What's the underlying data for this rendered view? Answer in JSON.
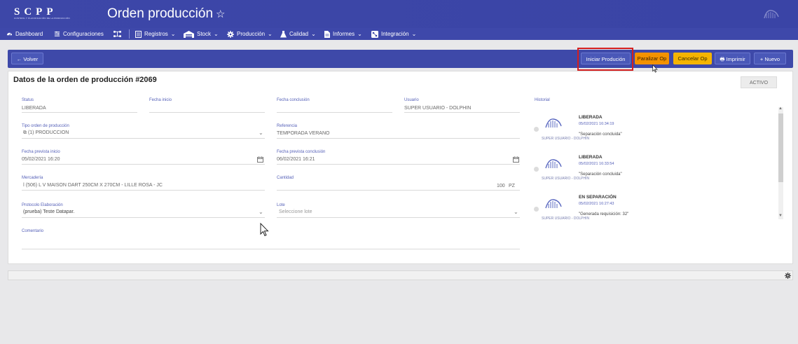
{
  "header": {
    "logo_text": "SCPP",
    "logo_subtitle": "CONTROL Y PLANIFICACIÓN DE LA PRODUCCIÓN",
    "title": "Orden producción",
    "star_icon": "star-outline-icon"
  },
  "nav": {
    "items": [
      {
        "label": "Dashboard",
        "icon": "dashboard-icon"
      },
      {
        "label": "Configuraciones",
        "icon": "sliders-icon"
      },
      {
        "label": "",
        "icon": "workflow-icon"
      },
      {
        "label": "Registros",
        "icon": "register-icon"
      },
      {
        "label": "Stock",
        "icon": "warehouse-icon"
      },
      {
        "label": "Producción",
        "icon": "gear-icon"
      },
      {
        "label": "Calidad",
        "icon": "flask-icon"
      },
      {
        "label": "Informes",
        "icon": "document-icon"
      },
      {
        "label": "Integración",
        "icon": "integration-icon"
      }
    ]
  },
  "actions": {
    "back": "Volver",
    "start": "Iniciar Produción",
    "pause": "Paralizar Op",
    "cancel": "Cancelar Op",
    "print": "Imprimir",
    "new": "Nuevo"
  },
  "form": {
    "title": "Datos de la orden de producción #2069",
    "status_badge": "ACTIVO",
    "status": {
      "label": "Status",
      "value": "LIBERADA"
    },
    "fecha_inicio": {
      "label": "Fecha inicio",
      "value": ""
    },
    "fecha_conclusion": {
      "label": "Fecha conclusión",
      "value": ""
    },
    "usuario": {
      "label": "Usuario",
      "value": "SUPER USUARIO - DOLPHIN"
    },
    "tipo_orden": {
      "label": "Tipo orden de producción",
      "value": "(1) PRODUCCION"
    },
    "referencia": {
      "label": "Referencia",
      "value": "TEMPORADA VERANO"
    },
    "fecha_prevista_inicio": {
      "label": "Fecha prevista inicio",
      "value": "05/02/2021 16:20"
    },
    "fecha_prevista_conclusion": {
      "label": "Fecha prevista conclusión",
      "value": "06/02/2021 16:21"
    },
    "mercaderia": {
      "label": "Mercadería",
      "value": "(506) L V MAISON DART 250CM X 270CM - LILLE ROSA - JC"
    },
    "cantidad": {
      "label": "Cantidad",
      "value": "100",
      "unit": "PZ"
    },
    "protocolo": {
      "label": "Protocolo Elaboración",
      "value": "(prueba) Teste Datapar."
    },
    "lote": {
      "label": "Lote",
      "placeholder": "Seleccione lote"
    },
    "comentario": {
      "label": "Comentario",
      "value": ""
    }
  },
  "historial": {
    "label": "Historial",
    "entries": [
      {
        "title": "LIBERADA",
        "date": "05/02/2021 16:34:19",
        "desc": "\"Separación concluida\"",
        "user": "SUPER USUARIO - DOLPHIN"
      },
      {
        "title": "LIBERADA",
        "date": "05/02/2021 16:33:54",
        "desc": "\"Separación concluida\"",
        "user": "SUPER USUARIO - DOLPHIN"
      },
      {
        "title": "EN SEPARACIÓN",
        "date": "05/02/2021 16:27:43",
        "desc": "\"Generada requisición: 32\"",
        "user": "SUPER USUARIO - DOLPHIN"
      }
    ]
  },
  "colors": {
    "brand": "#3d47a8",
    "highlight": "#d41f1f",
    "pause": "#f39200",
    "cancel": "#f5b400"
  }
}
